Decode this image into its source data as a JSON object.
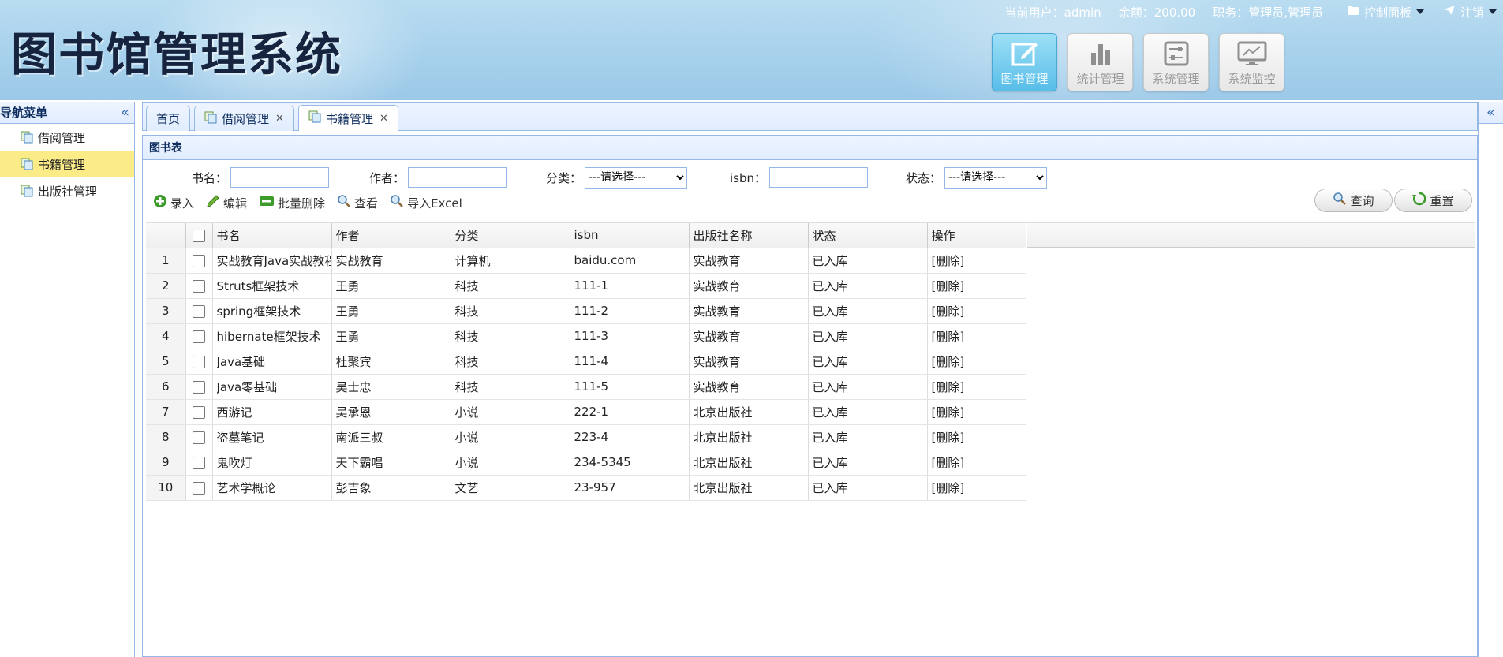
{
  "header": {
    "app_title": "图书馆管理系统",
    "current_user_label": "当前用户：admin",
    "balance_label": "余额：200.00",
    "role_label": "职务：管理员,管理员",
    "control_panel_label": "控制面板",
    "logout_label": "注销",
    "tiles": [
      {
        "label": "图书管理",
        "icon": "edit-icon",
        "active": true
      },
      {
        "label": "统计管理",
        "icon": "bar-chart-icon",
        "active": false
      },
      {
        "label": "系统管理",
        "icon": "sliders-icon",
        "active": false
      },
      {
        "label": "系统监控",
        "icon": "monitor-icon",
        "active": false
      }
    ]
  },
  "nav": {
    "title": "导航菜单",
    "items": [
      {
        "label": "借阅管理",
        "selected": false
      },
      {
        "label": "书籍管理",
        "selected": true
      },
      {
        "label": "出版社管理",
        "selected": false
      }
    ]
  },
  "tabs": [
    {
      "label": "首页",
      "closable": false,
      "active": false
    },
    {
      "label": "借阅管理",
      "closable": true,
      "active": false
    },
    {
      "label": "书籍管理",
      "closable": true,
      "active": true
    }
  ],
  "panel": {
    "title": "图书表"
  },
  "search": {
    "book_name_label": "书名：",
    "book_name_value": "",
    "author_label": "作者：",
    "author_value": "",
    "category_label": "分类：",
    "category_selected": "---请选择---",
    "isbn_label": "isbn：",
    "isbn_value": "",
    "status_label": "状态：",
    "status_selected": "---请选择---"
  },
  "toolbar": {
    "add_label": "录入",
    "edit_label": "编辑",
    "batch_delete_label": "批量删除",
    "view_label": "查看",
    "import_label": "导入Excel",
    "query_label": "查询",
    "reset_label": "重置"
  },
  "table": {
    "columns": [
      "书名",
      "作者",
      "分类",
      "isbn",
      "出版社名称",
      "状态",
      "操作"
    ],
    "rows": [
      {
        "num": "1",
        "name": "实战教育Java实战教程",
        "author": "实战教育",
        "category": "计算机",
        "isbn": "baidu.com",
        "publisher": "实战教育",
        "status": "已入库",
        "action": "[删除]"
      },
      {
        "num": "2",
        "name": "Struts框架技术",
        "author": "王勇",
        "category": "科技",
        "isbn": "111-1",
        "publisher": "实战教育",
        "status": "已入库",
        "action": "[删除]"
      },
      {
        "num": "3",
        "name": "spring框架技术",
        "author": "王勇",
        "category": "科技",
        "isbn": "111-2",
        "publisher": "实战教育",
        "status": "已入库",
        "action": "[删除]"
      },
      {
        "num": "4",
        "name": "hibernate框架技术",
        "author": "王勇",
        "category": "科技",
        "isbn": "111-3",
        "publisher": "实战教育",
        "status": "已入库",
        "action": "[删除]"
      },
      {
        "num": "5",
        "name": "Java基础",
        "author": "杜聚宾",
        "category": "科技",
        "isbn": "111-4",
        "publisher": "实战教育",
        "status": "已入库",
        "action": "[删除]"
      },
      {
        "num": "6",
        "name": "Java零基础",
        "author": "吴士忠",
        "category": "科技",
        "isbn": "111-5",
        "publisher": "实战教育",
        "status": "已入库",
        "action": "[删除]"
      },
      {
        "num": "7",
        "name": "西游记",
        "author": "吴承恩",
        "category": "小说",
        "isbn": "222-1",
        "publisher": "北京出版社",
        "status": "已入库",
        "action": "[删除]"
      },
      {
        "num": "8",
        "name": "盗墓笔记",
        "author": "南派三叔",
        "category": "小说",
        "isbn": "223-4",
        "publisher": "北京出版社",
        "status": "已入库",
        "action": "[删除]"
      },
      {
        "num": "9",
        "name": "鬼吹灯",
        "author": "天下霸唱",
        "category": "小说",
        "isbn": "234-5345",
        "publisher": "北京出版社",
        "status": "已入库",
        "action": "[删除]"
      },
      {
        "num": "10",
        "name": "艺术学概论",
        "author": "彭吉象",
        "category": "文艺",
        "isbn": "23-957",
        "publisher": "北京出版社",
        "status": "已入库",
        "action": "[删除]"
      }
    ]
  },
  "colors": {
    "border": "#95b8e7",
    "selected_nav": "#fbec88",
    "title_dark": "#16243f",
    "active_tile": "#58bde8"
  }
}
